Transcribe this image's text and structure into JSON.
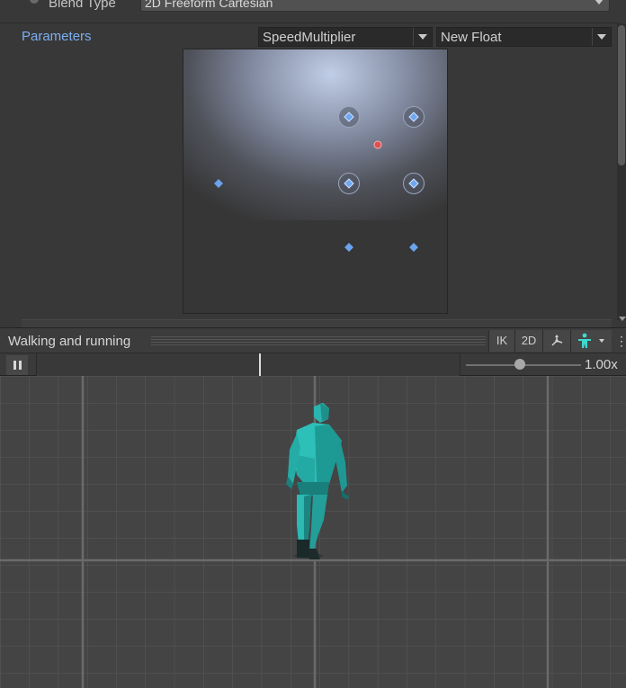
{
  "inspector": {
    "blend_type_label": "Blend Type",
    "blend_type_value": "2D Freeform Cartesian",
    "parameters_label": "Parameters",
    "param_x": "SpeedMultiplier",
    "param_y": "New Float"
  },
  "preview": {
    "title": "Walking and running",
    "ik_label": "IK",
    "mode_2d_label": "2D",
    "pivot_icon": "pivot-icon",
    "avatar_icon": "avatar-icon",
    "menu_icon": "kebab-menu-icon"
  },
  "timeline": {
    "pause_icon": "pause-icon",
    "speed": "1.00x"
  },
  "colors": {
    "accent_link": "#7aaef0",
    "node_blue": "#6ea7ef",
    "current_point": "#e05050",
    "character": "#2ab5b0"
  }
}
